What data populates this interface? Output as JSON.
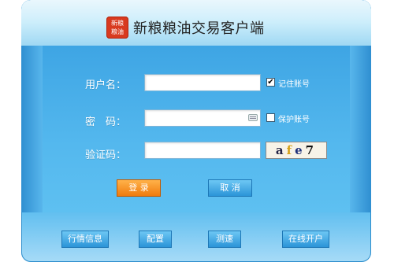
{
  "app": {
    "logo_text_line1": "新粮",
    "logo_text_line2": "粮油",
    "title": "新粮粮油交易客户端"
  },
  "form": {
    "username_label": "用户名：",
    "username_value": "",
    "password_label": "密　码：",
    "password_value": "",
    "captcha_label": "验证码：",
    "captcha_value": "",
    "captcha_text": [
      "a",
      "f",
      "e",
      "7"
    ],
    "remember_user": {
      "label": "记住账号",
      "checked": true,
      "mark": "✔"
    },
    "protect_account": {
      "label": "保护账号",
      "checked": false
    }
  },
  "buttons": {
    "login": "登 录",
    "cancel": "取 消"
  },
  "footer": {
    "items": [
      "行情信息",
      "配置",
      "测速",
      "在线开户"
    ]
  },
  "colors": {
    "accent_blue": "#3aa6e6",
    "login_orange": "#f07b0d",
    "logo_red": "#d83a1f"
  }
}
